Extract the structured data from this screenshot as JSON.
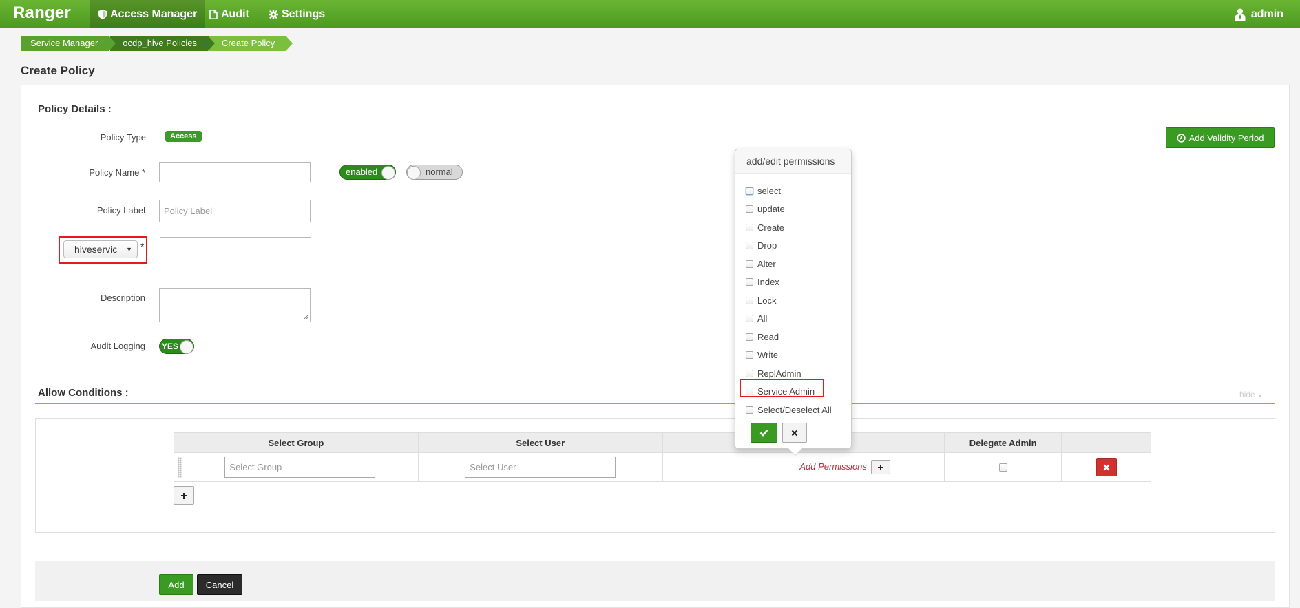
{
  "nav": {
    "brand": "Ranger",
    "items": [
      {
        "label": "Access Manager",
        "active": true,
        "icon": "shield-icon"
      },
      {
        "label": "Audit",
        "active": false,
        "icon": "file-icon"
      },
      {
        "label": "Settings",
        "active": false,
        "icon": "gear-icon"
      }
    ],
    "user": "admin"
  },
  "breadcrumb": [
    "Service Manager",
    "ocdp_hive Policies",
    "Create Policy"
  ],
  "page_title": "Create Policy",
  "policy_details": {
    "heading": "Policy Details :",
    "policy_type_label": "Policy Type",
    "policy_type_value": "Access",
    "add_validity_label": "Add Validity Period",
    "policy_name_label": "Policy Name *",
    "policy_name_value": "",
    "enabled_toggle": "enabled",
    "normal_toggle": "normal",
    "policy_label_label": "Policy Label",
    "policy_label_placeholder": "Policy Label",
    "resource_select_value": "hiveservic",
    "resource_required_mark": "*",
    "resource_value": "",
    "description_label": "Description",
    "audit_logging_label": "Audit Logging",
    "audit_logging_value": "YES"
  },
  "allow_conditions": {
    "heading": "Allow Conditions :",
    "hide_label": "hide",
    "columns": [
      "Select Group",
      "Select User",
      "",
      "Delegate Admin",
      ""
    ],
    "row": {
      "group_placeholder": "Select Group",
      "user_placeholder": "Select User",
      "add_permissions_label": "Add Permissions",
      "delegate_admin_checked": false
    }
  },
  "permissions_popover": {
    "title": "add/edit permissions",
    "items": [
      "select",
      "update",
      "Create",
      "Drop",
      "Alter",
      "Index",
      "Lock",
      "All",
      "Read",
      "Write",
      "ReplAdmin",
      "Service Admin",
      "Select/Deselect All"
    ],
    "highlighted_item": "Service Admin"
  },
  "footer": {
    "add_label": "Add",
    "cancel_label": "Cancel"
  },
  "colors": {
    "brand_green": "#4c9a21",
    "button_green": "#3a9b23",
    "highlight_red": "#e41b1b",
    "delete_red": "#d2322d"
  }
}
